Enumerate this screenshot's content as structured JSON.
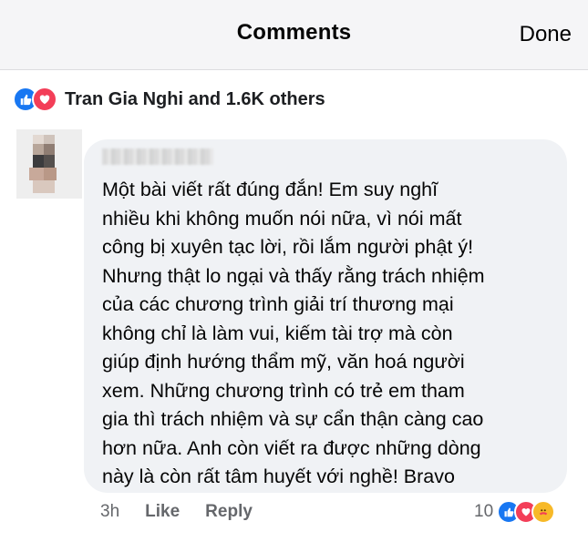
{
  "header": {
    "title": "Comments",
    "done_label": "Done"
  },
  "reactions_summary": {
    "text": "Tran Gia Nghi and 1.6K others",
    "icons": [
      "like-icon",
      "love-icon"
    ]
  },
  "comment": {
    "text": "Một bài viết rất đúng đắn! Em suy nghĩ\nnhiều khi không muốn nói nữa, vì nói mất\ncông bị xuyên tạc lời, rồi lắm người phật ý!\nNhưng thật lo ngại và thấy rằng trách nhiệm\ncủa các chương trình giải trí thương mại\nkhông chỉ là làm vui, kiếm tài trợ mà còn\ngiúp định hướng thẩm mỹ, văn hoá người\nxem. Những chương trình có trẻ em tham\ngia thì trách nhiệm và sự cẩn thận càng cao\nhơn nữa. Anh còn viết ra được những dòng\nnày là còn rất tâm huyết với nghề! Bravo",
    "time": "3h",
    "like_label": "Like",
    "reply_label": "Reply",
    "reaction_count": "10",
    "reaction_icons": [
      "like-icon",
      "love-icon",
      "care-icon"
    ]
  },
  "colors": {
    "like": "#1877f2",
    "love": "#f33e58",
    "care": "#f7b928",
    "bubble": "#f0f2f5",
    "meta_text": "#65676b"
  }
}
